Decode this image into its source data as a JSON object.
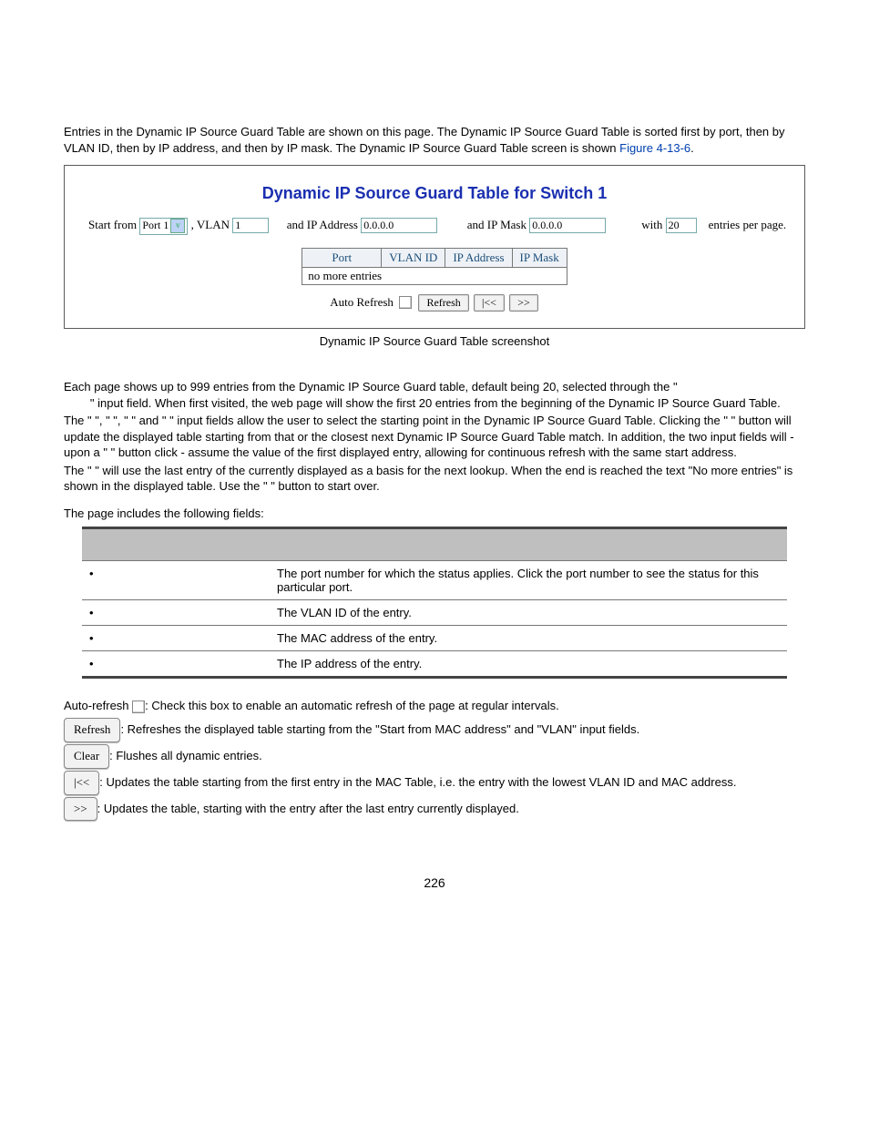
{
  "intro": {
    "line": "Entries in the Dynamic IP Source Guard Table are shown on this page. The Dynamic IP Source Guard Table is sorted first by port, then by VLAN ID, then by IP address, and then by IP mask. The Dynamic IP Source Guard Table screen is shown ",
    "figref": "Figure 4-13-6"
  },
  "fig": {
    "title": "Dynamic IP Source Guard Table for Switch 1",
    "start_from": "Start from",
    "port_sel": "Port 1",
    "vlan_lbl": ", VLAN",
    "vlan_val": "1",
    "ip_lbl": "and IP Address",
    "ip_val": "0.0.0.0",
    "mask_lbl": "and IP Mask",
    "mask_val": "0.0.0.0",
    "with_lbl": "with",
    "with_val": "20",
    "epp": "entries per page.",
    "th_port": "Port",
    "th_vlan": "VLAN ID",
    "th_ip": "IP Address",
    "th_mask": "IP Mask",
    "no_more": "no more entries",
    "auto_refresh": "Auto Refresh",
    "refresh_btn": "Refresh",
    "first_btn": "|<<",
    "next_btn": ">>",
    "caption": "Dynamic IP Source Guard Table screenshot"
  },
  "body": {
    "p1a": "Each page shows up to 999 entries from the Dynamic IP Source Guard table, default being 20, selected through the \"",
    "p1b": "\" input field. When first visited, the web page will show the first 20 entries from the beginning of the Dynamic IP Source Guard Table.",
    "p2": "The \"                                      \", \"            \", \"                      \" and \"               \" input fields allow the user to select the starting point in the Dynamic IP Source Guard Table. Clicking the \"               \" button will update the displayed table starting from that or the closest next Dynamic IP Source Guard Table match. In addition, the two input fields will - upon a \"               \" button click - assume the value of the first displayed entry, allowing for continuous refresh with the same start address.",
    "p3": "The \"    \" will use the last entry of the currently displayed as a basis for the next lookup. When the end is reached the text \"No more entries\" is shown in the displayed table. Use the \"    \" button to start over.",
    "fields_hdr": "The page includes the following fields:"
  },
  "table": {
    "r1d": "The port number for which the status applies. Click the port number to see the status for this particular port.",
    "r2d": "The VLAN ID of the entry.",
    "r3d": "The MAC address of the entry.",
    "r4d": "The IP address of the entry."
  },
  "icons": {
    "auto": "Auto-refresh ",
    "auto2": ": Check this box to enable an automatic refresh of the page at regular intervals.",
    "refresh_lbl": "Refresh",
    "refresh_txt": ": Refreshes the displayed table starting from the \"Start from MAC address\" and \"VLAN\" input fields.",
    "clear_lbl": "Clear",
    "clear_txt": ": Flushes all dynamic entries.",
    "first_lbl": "|<<",
    "first_txt": ": Updates the table starting from the first entry in the MAC Table, i.e. the entry with the lowest VLAN ID and MAC address.",
    "next_lbl": ">>",
    "next_txt": ": Updates the table, starting with the entry after the last entry currently displayed."
  },
  "pagenum": "226"
}
